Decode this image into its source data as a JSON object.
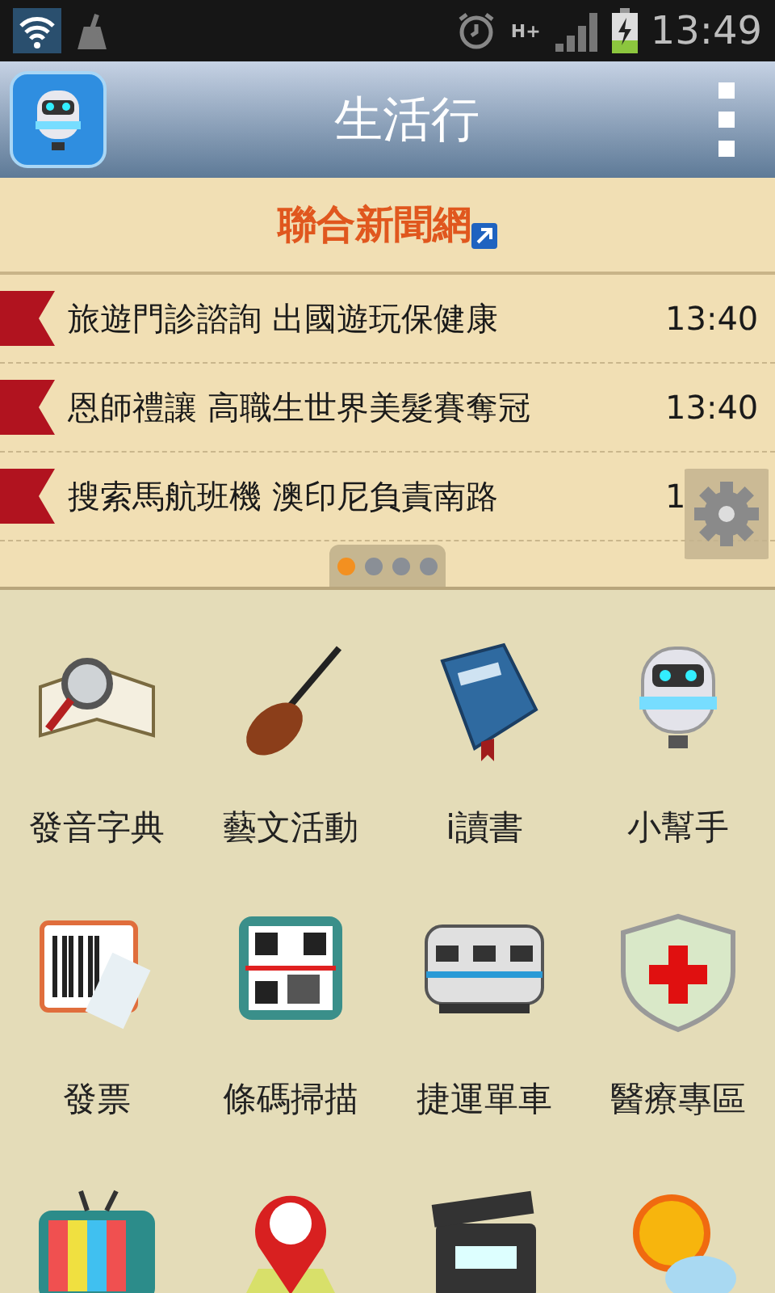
{
  "status_bar": {
    "network_type": "H+",
    "time": "13:49"
  },
  "app_bar": {
    "title": "生活行"
  },
  "news": {
    "source": "聯合新聞網",
    "items": [
      {
        "headline": "旅遊門診諮詢 出國遊玩保健康",
        "time": "13:40"
      },
      {
        "headline": "恩師禮讓 高職生世界美髮賽奪冠",
        "time": "13:40"
      },
      {
        "headline": "搜索馬航班機 澳印尼負責南路",
        "time": "1"
      }
    ],
    "pages": [
      {
        "selected": true
      },
      {
        "selected": false
      },
      {
        "selected": false
      },
      {
        "selected": false
      }
    ]
  },
  "apps": [
    {
      "kind": "dictionary",
      "label": "發音字典"
    },
    {
      "kind": "violin",
      "label": "藝文活動"
    },
    {
      "kind": "ebook",
      "label": "i讀書"
    },
    {
      "kind": "robot",
      "label": "小幫手"
    },
    {
      "kind": "receipt",
      "label": "發票"
    },
    {
      "kind": "qrcode",
      "label": "條碼掃描"
    },
    {
      "kind": "train",
      "label": "捷運單車"
    },
    {
      "kind": "shield",
      "label": "醫療專區"
    },
    {
      "kind": "tv"
    },
    {
      "kind": "mappin"
    },
    {
      "kind": "clapper"
    },
    {
      "kind": "weather"
    }
  ]
}
